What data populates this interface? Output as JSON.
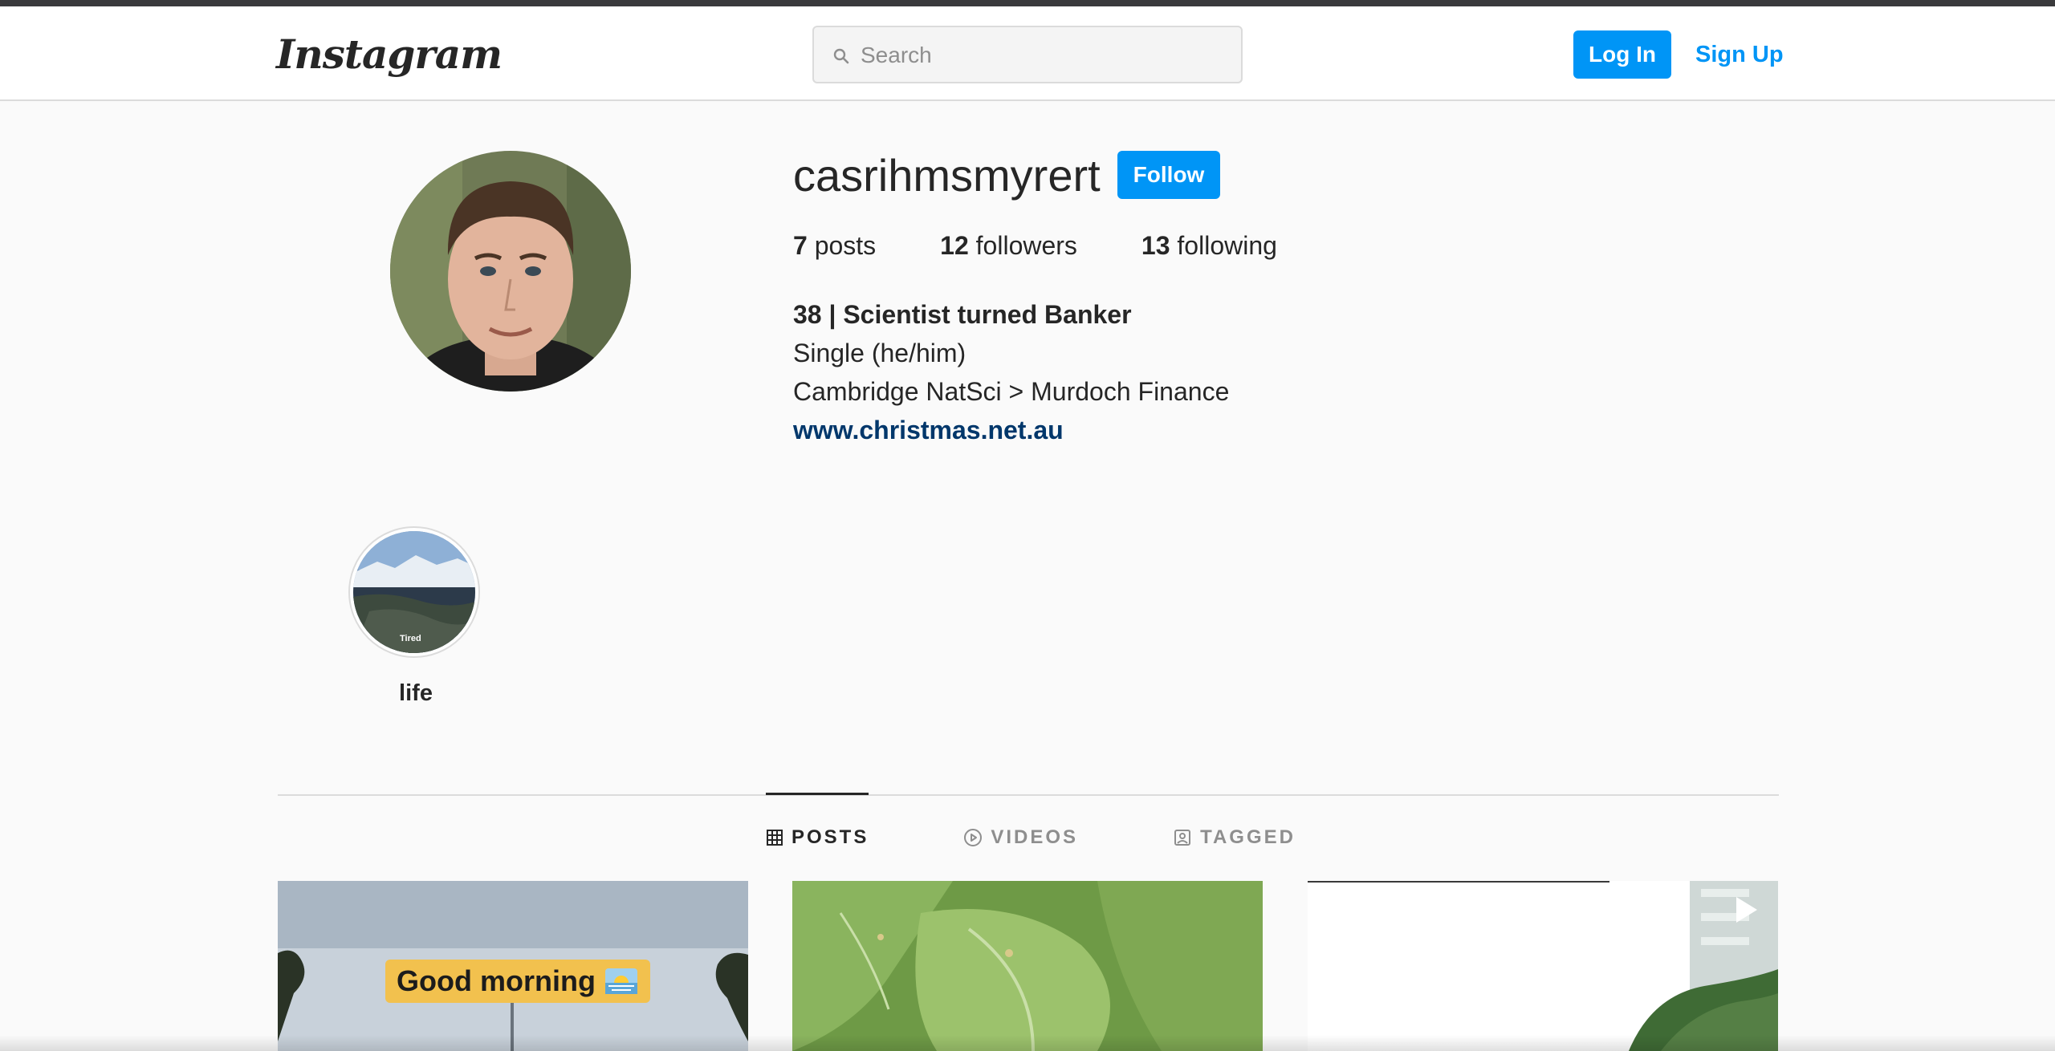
{
  "header": {
    "logo_text": "Instagram",
    "search_placeholder": "Search",
    "login_label": "Log In",
    "signup_label": "Sign Up"
  },
  "profile": {
    "username": "casrihmsmyrert",
    "follow_label": "Follow",
    "stats": {
      "posts_count": "7",
      "posts_label": "posts",
      "followers_count": "12",
      "followers_label": "followers",
      "following_count": "13",
      "following_label": "following"
    },
    "bio": {
      "name": "38 | Scientist turned Banker",
      "line1": "Single (he/him)",
      "line2": "Cambridge NatSci > Murdoch Finance",
      "link": "www.christmas.net.au"
    }
  },
  "highlights": [
    {
      "label": "life",
      "thumb_text": "Tired"
    }
  ],
  "tabs": [
    {
      "label": "POSTS",
      "icon": "grid-icon",
      "active": true
    },
    {
      "label": "VIDEOS",
      "icon": "play-circle-icon",
      "active": false
    },
    {
      "label": "TAGGED",
      "icon": "tagged-user-icon",
      "active": false
    }
  ],
  "posts": [
    {
      "overlay_text": "Good morning"
    },
    {
      "overlay_text": ""
    },
    {
      "overlay_text": ""
    }
  ],
  "colors": {
    "accent": "#0095f6",
    "link": "#00376b",
    "background": "#fafafa"
  }
}
